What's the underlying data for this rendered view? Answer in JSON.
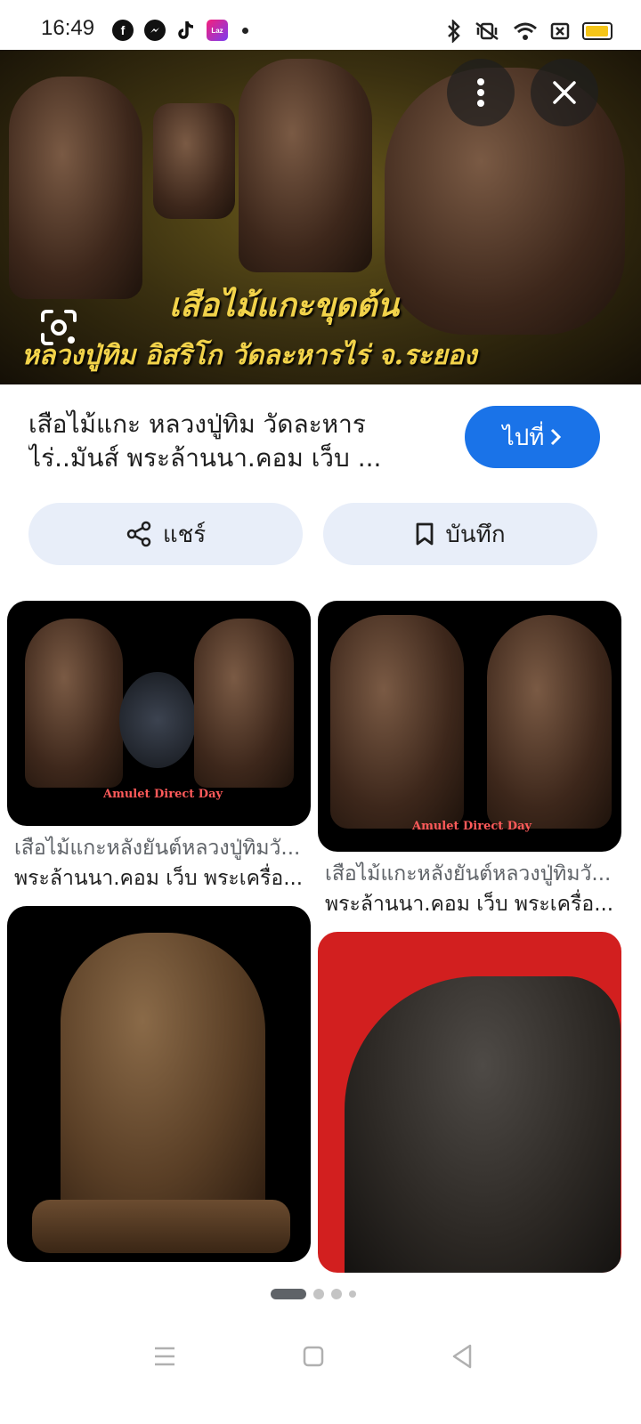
{
  "status_bar": {
    "time": "16:49",
    "apps": [
      "facebook-icon",
      "messenger-icon",
      "tiktok-icon",
      "lazada-icon"
    ],
    "lazada_label": "Laz",
    "right_icons": [
      "bluetooth-icon",
      "vibrate-icon",
      "wifi-icon",
      "no-sim-icon",
      "battery-icon"
    ]
  },
  "hero": {
    "caption_line1": "เสือไม้แกะขุดต้น",
    "caption_line2": "หลวงปู่ทิม  อิสริโก  วัดละหารไร่  จ.ระยอง"
  },
  "result": {
    "title_line1": "เสือไม้แกะ หลวงปู่ทิม วัดละหาร",
    "title_line2": "ไร่..มันส์ พระล้านนา.คอม เว็บ ...",
    "visit_label": "ไปที่"
  },
  "actions": {
    "share_label": "แชร์",
    "save_label": "บันทึก"
  },
  "grid": [
    {
      "caption1": "เสือไม้แกะหลังยันต์หลวงปู่ทิมวั...",
      "caption2": "พระล้านนา.คอม เว็บ พระเครื่อ...",
      "watermark": "Amulet Direct Day"
    },
    {
      "caption1": "เสือไม้แกะหลังยันต์หลวงปู่ทิมวั...",
      "caption2": "พระล้านนา.คอม เว็บ พระเครื่อ...",
      "watermark": "Amulet Direct Day"
    },
    {
      "caption1": "",
      "caption2": ""
    },
    {
      "caption1": "",
      "caption2": ""
    }
  ],
  "pager": {
    "pages": 4,
    "current": 1
  },
  "colors": {
    "accent": "#1a73e8",
    "pill_bg": "#e8eef9",
    "hero_text": "#f2d34a"
  }
}
